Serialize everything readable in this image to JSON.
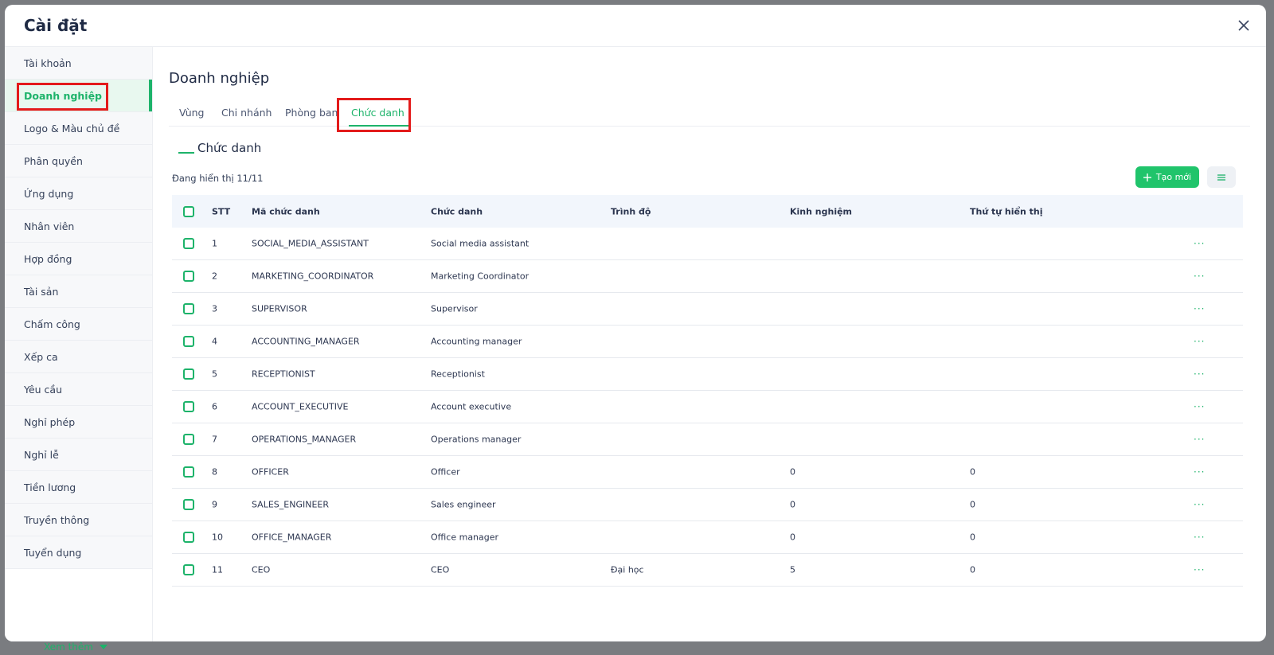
{
  "background": {
    "more_label": "Xem thêm"
  },
  "modal": {
    "title": "Cài đặt"
  },
  "sidebar": {
    "items": [
      {
        "label": "Tài khoản"
      },
      {
        "label": "Doanh nghiệp"
      },
      {
        "label": "Logo & Màu chủ đề"
      },
      {
        "label": "Phân quyền"
      },
      {
        "label": "Ứng dụng"
      },
      {
        "label": "Nhân viên"
      },
      {
        "label": "Hợp đồng"
      },
      {
        "label": "Tài sản"
      },
      {
        "label": "Chấm công"
      },
      {
        "label": "Xếp ca"
      },
      {
        "label": "Yêu cầu"
      },
      {
        "label": "Nghỉ phép"
      },
      {
        "label": "Nghỉ lễ"
      },
      {
        "label": "Tiền lương"
      },
      {
        "label": "Truyền thông"
      },
      {
        "label": "Tuyển dụng"
      }
    ],
    "active_index": 1
  },
  "main": {
    "section_title": "Doanh nghiệp",
    "tabs": [
      {
        "label": "Vùng"
      },
      {
        "label": "Chi nhánh"
      },
      {
        "label": "Phòng ban"
      },
      {
        "label": "Chức danh"
      }
    ],
    "active_tab": 3,
    "sub_title": "Chức danh",
    "count_text": "Đang hiển thị 11/11",
    "create_label": "Tạo mới"
  },
  "table": {
    "headers": {
      "stt": "STT",
      "code": "Mã chức danh",
      "title": "Chức danh",
      "level": "Trình độ",
      "experience": "Kinh nghiệm",
      "order": "Thứ tự hiển thị"
    },
    "rows": [
      {
        "stt": "1",
        "code": "SOCIAL_MEDIA_ASSISTANT",
        "title": "Social media assistant",
        "level": "",
        "experience": "",
        "order": ""
      },
      {
        "stt": "2",
        "code": "MARKETING_COORDINATOR",
        "title": "Marketing Coordinator",
        "level": "",
        "experience": "",
        "order": ""
      },
      {
        "stt": "3",
        "code": "SUPERVISOR",
        "title": "Supervisor",
        "level": "",
        "experience": "",
        "order": ""
      },
      {
        "stt": "4",
        "code": "ACCOUNTING_MANAGER",
        "title": "Accounting manager",
        "level": "",
        "experience": "",
        "order": ""
      },
      {
        "stt": "5",
        "code": "RECEPTIONIST",
        "title": "Receptionist",
        "level": "",
        "experience": "",
        "order": ""
      },
      {
        "stt": "6",
        "code": "ACCOUNT_EXECUTIVE",
        "title": "Account executive",
        "level": "",
        "experience": "",
        "order": ""
      },
      {
        "stt": "7",
        "code": "OPERATIONS_MANAGER",
        "title": "Operations manager",
        "level": "",
        "experience": "",
        "order": ""
      },
      {
        "stt": "8",
        "code": "OFFICER",
        "title": "Officer",
        "level": "",
        "experience": "0",
        "order": "0"
      },
      {
        "stt": "9",
        "code": "SALES_ENGINEER",
        "title": "Sales engineer",
        "level": "",
        "experience": "0",
        "order": "0"
      },
      {
        "stt": "10",
        "code": "OFFICE_MANAGER",
        "title": "Office manager",
        "level": "",
        "experience": "0",
        "order": "0"
      },
      {
        "stt": "11",
        "code": "CEO",
        "title": "CEO",
        "level": "Đại học",
        "experience": "5",
        "order": "0"
      }
    ],
    "row_action": "···"
  },
  "colors": {
    "accent": "#1db36a",
    "highlight": "#e31b1b"
  },
  "icons": {
    "close": "close-icon",
    "plus": "plus-icon",
    "menu": "menu-icon"
  }
}
